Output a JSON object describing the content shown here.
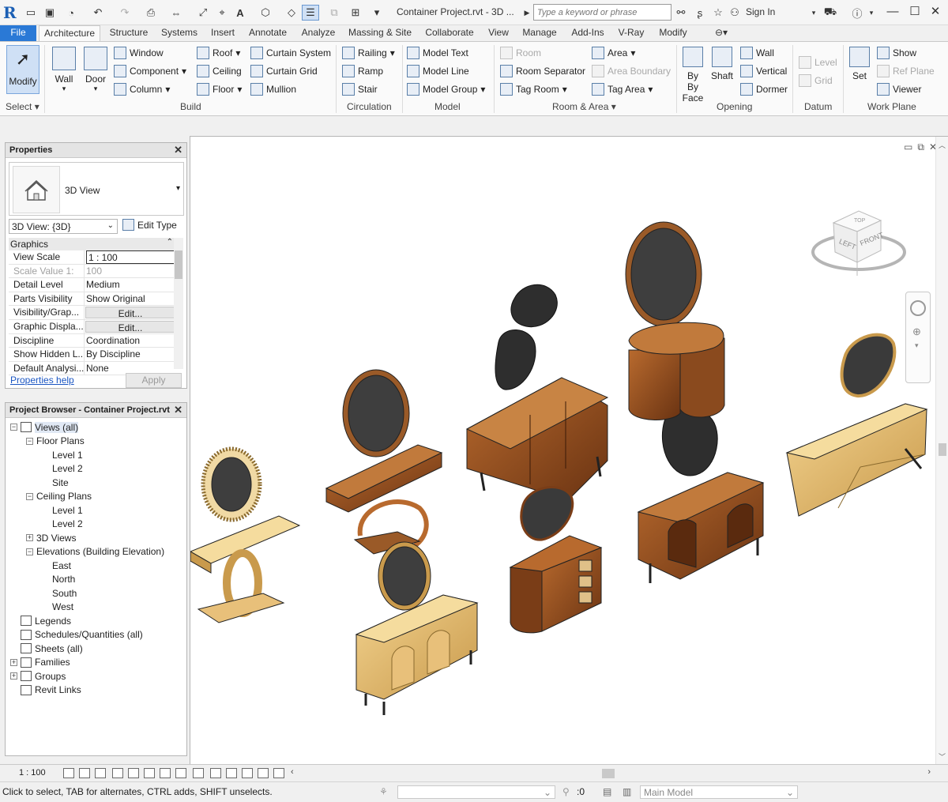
{
  "app": {
    "logo": "R",
    "title": "Container Project.rvt - 3D ...",
    "search_placeholder": "Type a keyword or phrase",
    "sign_in": "Sign In"
  },
  "tabs": [
    "File",
    "Architecture",
    "Structure",
    "Systems",
    "Insert",
    "Annotate",
    "Analyze",
    "Massing & Site",
    "Collaborate",
    "View",
    "Manage",
    "Add-Ins",
    "V-Ray",
    "Modify"
  ],
  "active_tab": "Architecture",
  "ribbon": {
    "select": {
      "modify": "Modify",
      "label": "Select"
    },
    "build": {
      "wall": "Wall",
      "door": "Door",
      "window": "Window",
      "component": "Component",
      "column": "Column",
      "roof": "Roof",
      "ceiling": "Ceiling",
      "floor": "Floor",
      "curtain_system": "Curtain System",
      "curtain_grid": "Curtain Grid",
      "mullion": "Mullion",
      "label": "Build"
    },
    "circulation": {
      "railing": "Railing",
      "ramp": "Ramp",
      "stair": "Stair",
      "label": "Circulation"
    },
    "model": {
      "model_text": "Model Text",
      "model_line": "Model Line",
      "model_group": "Model Group",
      "label": "Model"
    },
    "room_area": {
      "room": "Room",
      "room_separator": "Room Separator",
      "tag_room": "Tag Room",
      "area": "Area",
      "area_boundary": "Area Boundary",
      "tag_area": "Tag Area",
      "label": "Room & Area"
    },
    "opening": {
      "by_face": "By Face",
      "shaft": "Shaft",
      "wall": "Wall",
      "vertical": "Vertical",
      "dormer": "Dormer",
      "label": "Opening"
    },
    "datum": {
      "level": "Level",
      "grid": "Grid",
      "label": "Datum"
    },
    "work_plane": {
      "set": "Set",
      "show": "Show",
      "ref_plane": "Ref Plane",
      "viewer": "Viewer",
      "label": "Work Plane"
    }
  },
  "properties": {
    "title": "Properties",
    "type_name": "3D View",
    "view_selector": "3D View: {3D}",
    "edit_type": "Edit Type",
    "group": "Graphics",
    "rows": [
      {
        "key": "View Scale",
        "value": "1 : 100"
      },
      {
        "key": "Scale Value    1:",
        "value": "100"
      },
      {
        "key": "Detail Level",
        "value": "Medium"
      },
      {
        "key": "Parts Visibility",
        "value": "Show Original"
      },
      {
        "key": "Visibility/Grap...",
        "value": "Edit..."
      },
      {
        "key": "Graphic Displa...",
        "value": "Edit..."
      },
      {
        "key": "Discipline",
        "value": "Coordination"
      },
      {
        "key": "Show Hidden L...",
        "value": "By Discipline"
      },
      {
        "key": "Default Analysi...",
        "value": "None"
      }
    ],
    "help": "Properties help",
    "apply": "Apply"
  },
  "project_browser": {
    "title": "Project Browser - Container Project.rvt",
    "nodes": [
      {
        "label": "Views (all)",
        "level": 0,
        "exp": "−",
        "selected": true
      },
      {
        "label": "Floor Plans",
        "level": 1,
        "exp": "−"
      },
      {
        "label": "Level 1",
        "level": 2
      },
      {
        "label": "Level 2",
        "level": 2
      },
      {
        "label": "Site",
        "level": 2
      },
      {
        "label": "Ceiling Plans",
        "level": 1,
        "exp": "−"
      },
      {
        "label": "Level 1",
        "level": 2
      },
      {
        "label": "Level 2",
        "level": 2
      },
      {
        "label": "3D Views",
        "level": 1,
        "exp": "+"
      },
      {
        "label": "Elevations (Building Elevation)",
        "level": 1,
        "exp": "−"
      },
      {
        "label": "East",
        "level": 2
      },
      {
        "label": "North",
        "level": 2
      },
      {
        "label": "South",
        "level": 2
      },
      {
        "label": "West",
        "level": 2
      },
      {
        "label": "Legends",
        "level": 0,
        "icon": true
      },
      {
        "label": "Schedules/Quantities (all)",
        "level": 0,
        "icon": true
      },
      {
        "label": "Sheets (all)",
        "level": 0,
        "icon": true
      },
      {
        "label": "Families",
        "level": 0,
        "exp": "+",
        "icon": true
      },
      {
        "label": "Groups",
        "level": 0,
        "exp": "+",
        "icon": true
      },
      {
        "label": "Revit Links",
        "level": 0,
        "icon": true
      }
    ]
  },
  "viewcube": {
    "top": "TOP",
    "left": "LEFT",
    "front": "FRONT"
  },
  "view_control": {
    "scale": "1 : 100"
  },
  "status": {
    "text": "Click to select, TAB for alternates, CTRL adds, SHIFT unselects.",
    "selection_count": ":0",
    "model": "Main Model"
  },
  "colors": {
    "file_tab": "#2a79d6",
    "accent": "#1b5fb4",
    "wood_dark": "#7a3d17",
    "wood_mid": "#a05a26",
    "wood_light": "#e8c07a",
    "glass": "#3e3e3e"
  }
}
